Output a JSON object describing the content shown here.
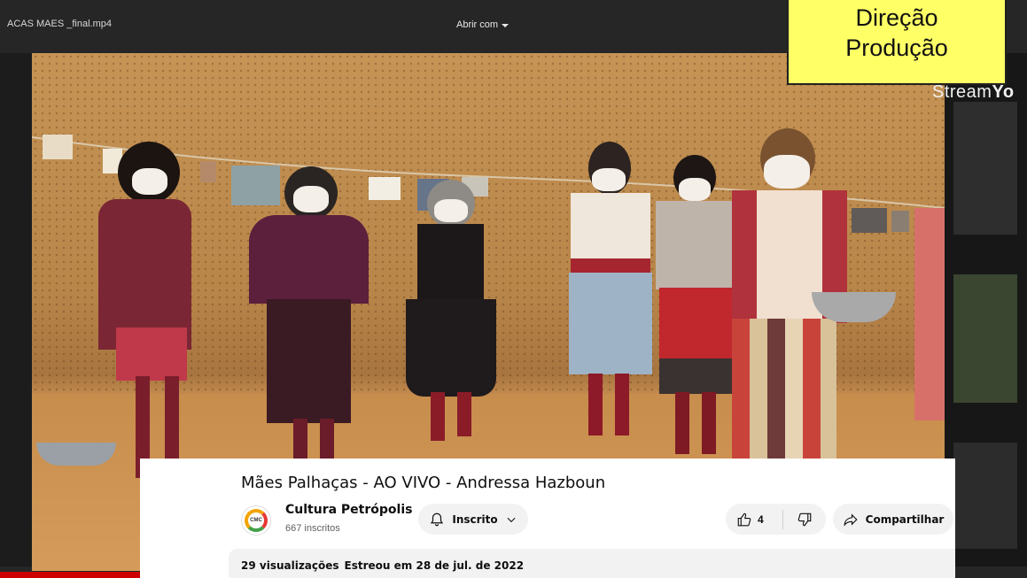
{
  "viewer": {
    "file_name": "ACAS MAES _final.mp4",
    "open_with_label": "Abrir com",
    "streamyard_prefix": "Stream",
    "streamyard_suffix": "Yo"
  },
  "credit_box": {
    "line1": "Direção",
    "line2": "Produção",
    "background": "#ffff66"
  },
  "video": {
    "title": "Mães Palhaças - AO VIVO - Andressa Hazboun",
    "channel": {
      "name": "Cultura Petrópolis",
      "subscribers": "667 inscritos",
      "avatar_text": "CMC"
    },
    "subscribe_label": "Inscrito",
    "like_count": "4",
    "share_label": "Compartilhar",
    "views": "29 visualizações",
    "premiered": "Estreou em 28 de jul. de 2022"
  },
  "colors": {
    "progress_red": "#cc0000",
    "panel_gray": "#f2f2f2"
  },
  "icons": [
    "chevron-down-icon",
    "bell-icon",
    "thumbs-up-icon",
    "thumbs-down-icon",
    "share-icon"
  ]
}
